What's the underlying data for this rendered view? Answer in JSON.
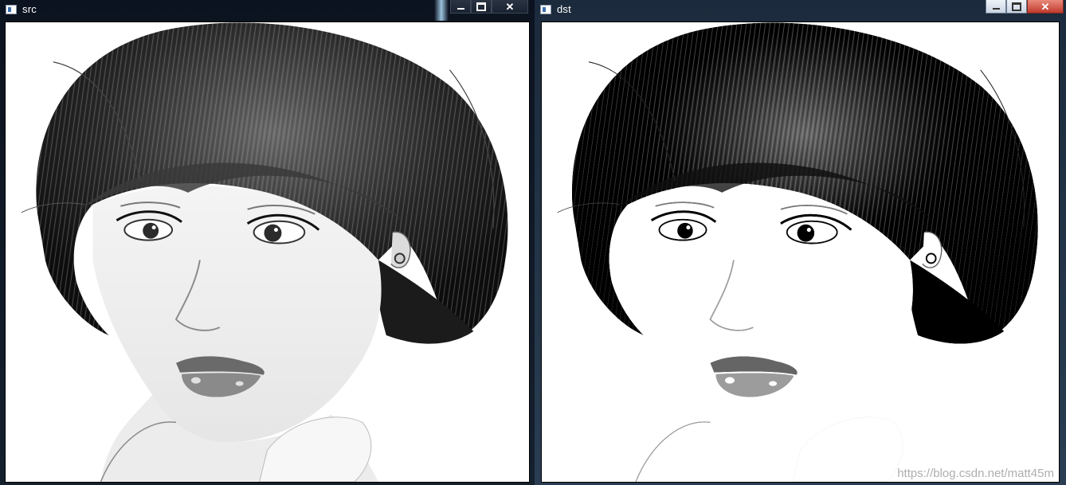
{
  "windows": [
    {
      "title": "src"
    },
    {
      "title": "dst"
    }
  ],
  "controls": {
    "minimize_icon": "minimize-icon",
    "maximize_icon": "maximize-icon",
    "close_icon": "close-icon"
  },
  "watermark": "https://blog.csdn.net/matt45m",
  "colors": {
    "close_red": "#c0392b",
    "title_dark": "#0c1320"
  }
}
